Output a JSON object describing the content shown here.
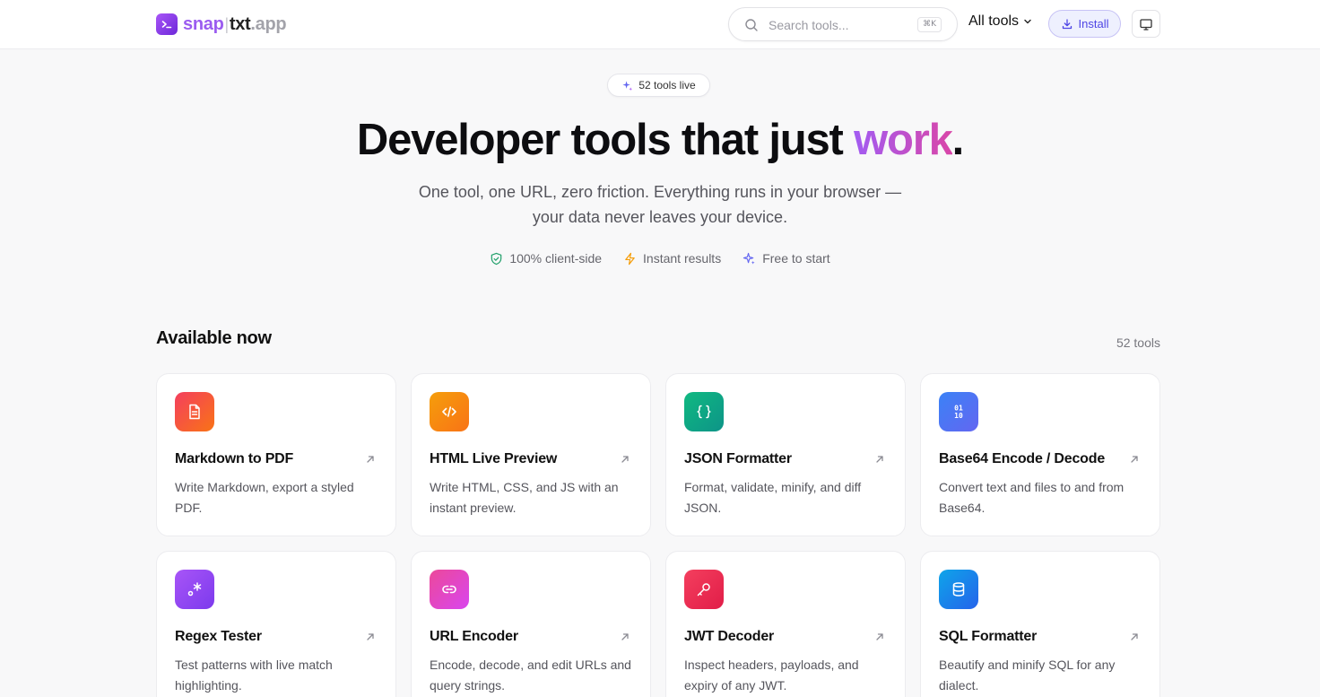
{
  "header": {
    "brand": {
      "part1": "snap",
      "separator": "|",
      "part2": "txt",
      "part3": ".app"
    },
    "search": {
      "placeholder": "Search tools...",
      "shortcut": "⌘K"
    },
    "all_tools_label": "All tools",
    "install_label": "Install"
  },
  "hero": {
    "pill_label": "52 tools live",
    "title_main": "Developer tools that just ",
    "title_accent": "work",
    "title_end": ".",
    "subtitle_line1": "One tool, one URL, zero friction. Everything runs in your browser —",
    "subtitle_line2": "your data never leaves your device.",
    "features": [
      {
        "label": "100% client-side",
        "icon": "shield-check-icon",
        "color": "#22a06b"
      },
      {
        "label": "Instant results",
        "icon": "lightning-icon",
        "color": "#f59e0b"
      },
      {
        "label": "Free to start",
        "icon": "sparkle-icon",
        "color": "#6366f1"
      }
    ]
  },
  "section": {
    "title": "Available now",
    "count": "52 tools"
  },
  "tools": [
    {
      "title": "Markdown to PDF",
      "description": "Write Markdown, export a styled PDF.",
      "icon": "document-icon",
      "color_from": "#f43f5e",
      "color_to": "#f97316"
    },
    {
      "title": "HTML Live Preview",
      "description": "Write HTML, CSS, and JS with an instant preview.",
      "icon": "code-icon",
      "color_from": "#f59e0b",
      "color_to": "#f97316"
    },
    {
      "title": "JSON Formatter",
      "description": "Format, validate, minify, and diff JSON.",
      "icon": "braces-icon",
      "color_from": "#10b981",
      "color_to": "#0d9488"
    },
    {
      "title": "Base64 Encode / Decode",
      "description": "Convert text and files to and from Base64.",
      "icon": "binary-icon",
      "color_from": "#3b82f6",
      "color_to": "#6366f1"
    },
    {
      "title": "Regex Tester",
      "description": "Test patterns with live match highlighting.",
      "icon": "regex-icon",
      "color_from": "#a855f7",
      "color_to": "#7c3aed"
    },
    {
      "title": "URL Encoder",
      "description": "Encode, decode, and edit URLs and query strings.",
      "icon": "link-icon",
      "color_from": "#ec4899",
      "color_to": "#d946ef"
    },
    {
      "title": "JWT Decoder",
      "description": "Inspect headers, payloads, and expiry of any JWT.",
      "icon": "key-icon",
      "color_from": "#f43f5e",
      "color_to": "#e11d48"
    },
    {
      "title": "SQL Formatter",
      "description": "Beautify and minify SQL for any dialect.",
      "icon": "database-icon",
      "color_from": "#0ea5e9",
      "color_to": "#2563eb"
    }
  ]
}
